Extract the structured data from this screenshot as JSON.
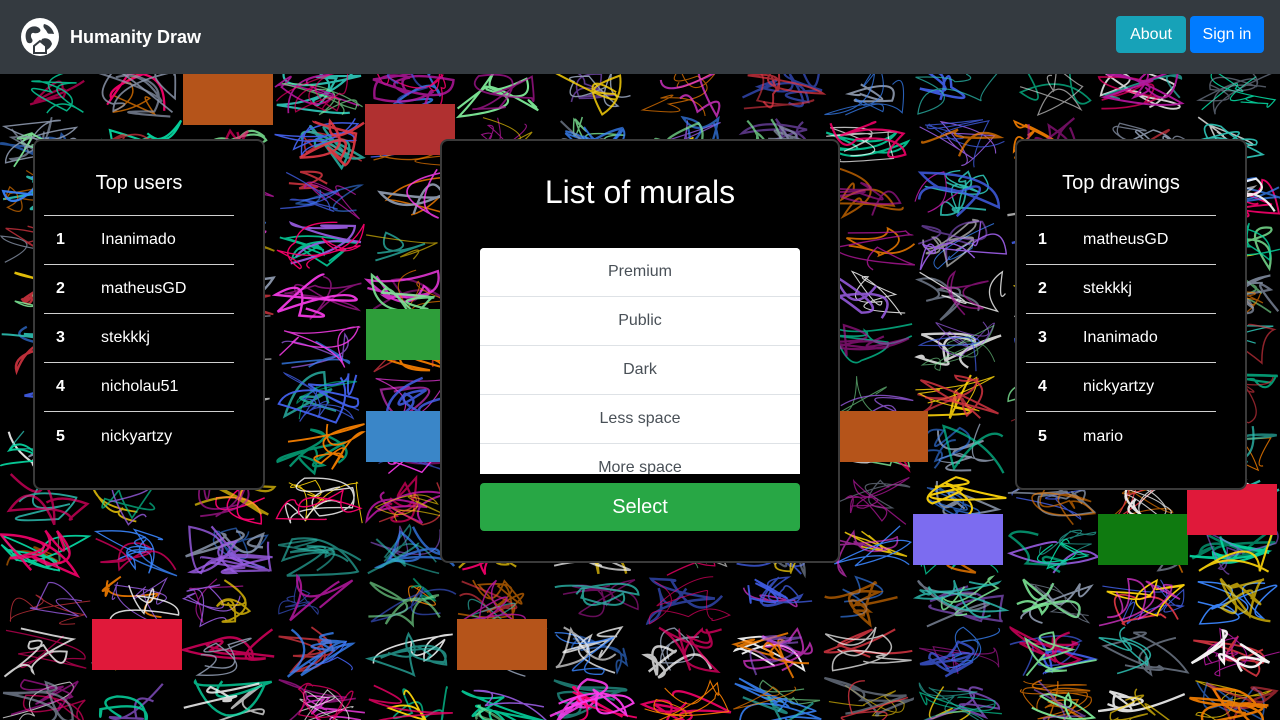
{
  "app": {
    "name": "Humanity Draw",
    "logo_icon": "globe-icon"
  },
  "nav": {
    "about_label": "About",
    "signin_label": "Sign in",
    "about_color": "#17a2b8",
    "signin_color": "#007bff"
  },
  "top_users": {
    "title": "Top users",
    "items": [
      {
        "rank": "1",
        "name": "Inanimado"
      },
      {
        "rank": "2",
        "name": "matheusGD"
      },
      {
        "rank": "3",
        "name": "stekkkj"
      },
      {
        "rank": "4",
        "name": "nicholau51"
      },
      {
        "rank": "5",
        "name": "nickyartzy"
      }
    ]
  },
  "murals": {
    "title": "List of murals",
    "options": [
      "Premium",
      "Public",
      "Dark",
      "Less space",
      "More space"
    ],
    "select_label": "Select",
    "select_color": "#28a745"
  },
  "top_drawings": {
    "title": "Top drawings",
    "items": [
      {
        "rank": "1",
        "name": "matheusGD"
      },
      {
        "rank": "2",
        "name": "stekkkj"
      },
      {
        "rank": "3",
        "name": "Inanimado"
      },
      {
        "rank": "4",
        "name": "nickyartzy"
      },
      {
        "rank": "5",
        "name": "mario"
      }
    ]
  }
}
